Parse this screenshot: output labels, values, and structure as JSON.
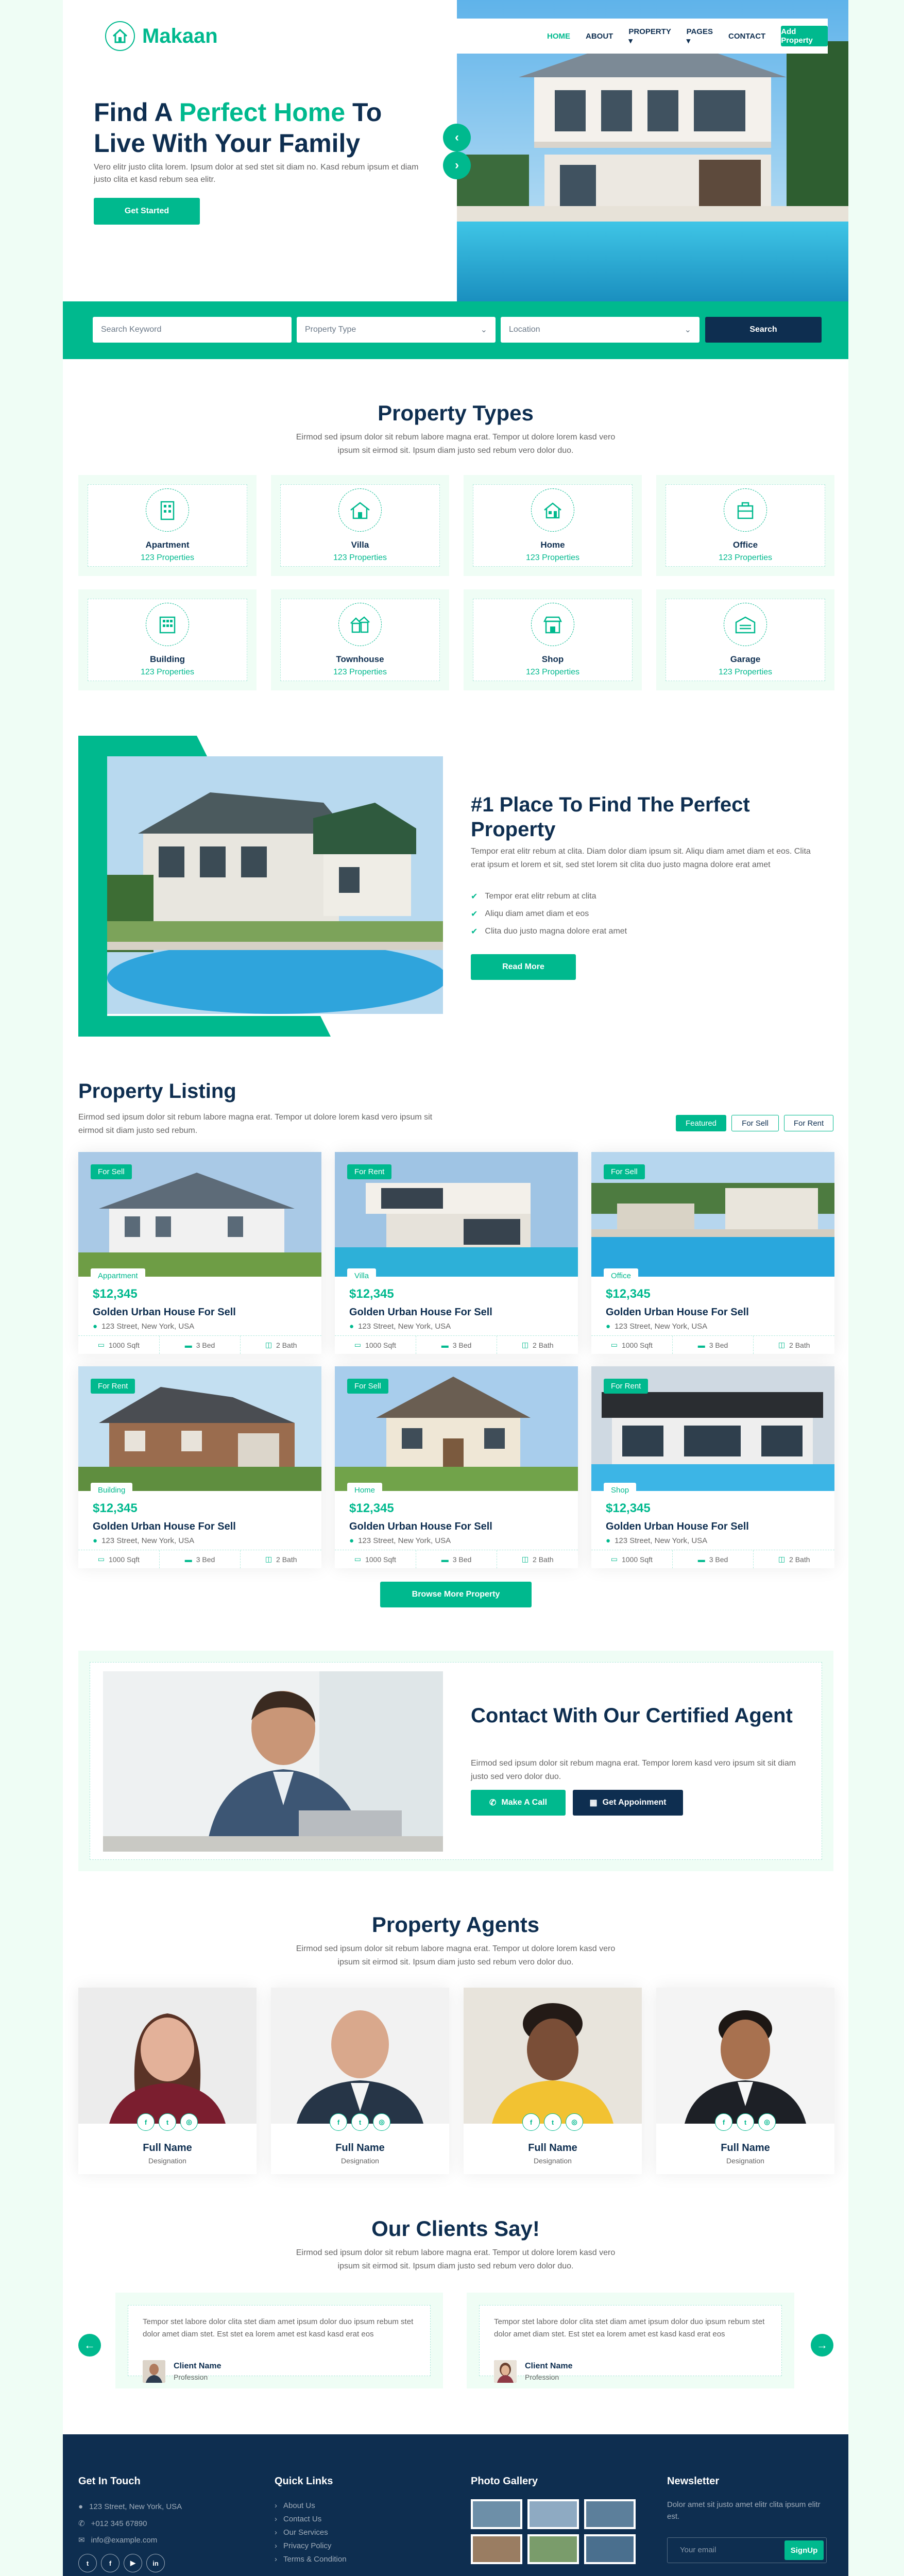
{
  "nav": {
    "logo": "Makaan",
    "links": [
      "Home",
      "About",
      "Property",
      "Pages",
      "Contact"
    ],
    "cta": "Add Property"
  },
  "hero": {
    "title_a": "Find A",
    "title_b": "Perfect Home",
    "title_c": "To",
    "title_d": "Live With Your Family",
    "text": "Vero elitr justo clita lorem. Ipsum dolor at sed stet sit diam no. Kasd rebum ipsum et diam justo clita et kasd rebum sea elitr.",
    "button": "Get Started"
  },
  "search": {
    "keyword_placeholder": "Search Keyword",
    "type_placeholder": "Property Type",
    "location_placeholder": "Location",
    "button": "Search"
  },
  "types": {
    "title": "Property Types",
    "subtitle": "Eirmod sed ipsum dolor sit rebum labore magna erat. Tempor ut dolore lorem kasd vero ipsum sit eirmod sit. Ipsum diam justo sed rebum vero dolor duo.",
    "items": [
      {
        "name": "Apartment",
        "count": "123 Properties"
      },
      {
        "name": "Villa",
        "count": "123 Properties"
      },
      {
        "name": "Home",
        "count": "123 Properties"
      },
      {
        "name": "Office",
        "count": "123 Properties"
      },
      {
        "name": "Building",
        "count": "123 Properties"
      },
      {
        "name": "Townhouse",
        "count": "123 Properties"
      },
      {
        "name": "Shop",
        "count": "123 Properties"
      },
      {
        "name": "Garage",
        "count": "123 Properties"
      }
    ]
  },
  "about": {
    "title": "#1 Place To Find The Perfect Property",
    "text": "Tempor erat elitr rebum at clita. Diam dolor diam ipsum sit. Aliqu diam amet diam et eos. Clita erat ipsum et lorem et sit, sed stet lorem sit clita duo justo magna dolore erat amet",
    "checks": [
      "Tempor erat elitr rebum at clita",
      "Aliqu diam amet diam et eos",
      "Clita duo justo magna dolore erat amet"
    ],
    "button": "Read More"
  },
  "listing": {
    "title": "Property Listing",
    "subtitle": "Eirmod sed ipsum dolor sit rebum labore magna erat. Tempor ut dolore lorem kasd vero ipsum sit eirmod sit diam justo sed rebum.",
    "tabs": [
      "Featured",
      "For Sell",
      "For Rent"
    ],
    "cards": [
      {
        "status": "For Sell",
        "type": "Appartment",
        "price": "$12,345",
        "name": "Golden Urban House For Sell",
        "address": "123 Street, New York, USA",
        "sqft": "1000 Sqft",
        "bed": "3 Bed",
        "bath": "2 Bath"
      },
      {
        "status": "For Rent",
        "type": "Villa",
        "price": "$12,345",
        "name": "Golden Urban House For Sell",
        "address": "123 Street, New York, USA",
        "sqft": "1000 Sqft",
        "bed": "3 Bed",
        "bath": "2 Bath"
      },
      {
        "status": "For Sell",
        "type": "Office",
        "price": "$12,345",
        "name": "Golden Urban House For Sell",
        "address": "123 Street, New York, USA",
        "sqft": "1000 Sqft",
        "bed": "3 Bed",
        "bath": "2 Bath"
      },
      {
        "status": "For Rent",
        "type": "Building",
        "price": "$12,345",
        "name": "Golden Urban House For Sell",
        "address": "123 Street, New York, USA",
        "sqft": "1000 Sqft",
        "bed": "3 Bed",
        "bath": "2 Bath"
      },
      {
        "status": "For Sell",
        "type": "Home",
        "price": "$12,345",
        "name": "Golden Urban House For Sell",
        "address": "123 Street, New York, USA",
        "sqft": "1000 Sqft",
        "bed": "3 Bed",
        "bath": "2 Bath"
      },
      {
        "status": "For Rent",
        "type": "Shop",
        "price": "$12,345",
        "name": "Golden Urban House For Sell",
        "address": "123 Street, New York, USA",
        "sqft": "1000 Sqft",
        "bed": "3 Bed",
        "bath": "2 Bath"
      }
    ],
    "more": "Browse More Property"
  },
  "contact": {
    "title": "Contact With Our Certified Agent",
    "text": "Eirmod sed ipsum dolor sit rebum magna erat. Tempor lorem kasd vero ipsum sit sit diam justo sed vero dolor duo.",
    "call": "Make A Call",
    "appointment": "Get Appoinment"
  },
  "agents": {
    "title": "Property Agents",
    "subtitle": "Eirmod sed ipsum dolor sit rebum labore magna erat. Tempor ut dolore lorem kasd vero ipsum sit eirmod sit. Ipsum diam justo sed rebum vero dolor duo.",
    "items": [
      {
        "name": "Full Name",
        "role": "Designation"
      },
      {
        "name": "Full Name",
        "role": "Designation"
      },
      {
        "name": "Full Name",
        "role": "Designation"
      },
      {
        "name": "Full Name",
        "role": "Designation"
      }
    ]
  },
  "clients": {
    "title": "Our Clients Say!",
    "subtitle": "Eirmod sed ipsum dolor sit rebum labore magna erat. Tempor ut dolore lorem kasd vero ipsum sit eirmod sit. Ipsum diam justo sed rebum vero dolor duo.",
    "items": [
      {
        "text": "Tempor stet labore dolor clita stet diam amet ipsum dolor duo ipsum rebum stet dolor amet diam stet. Est stet ea lorem amet est kasd kasd erat eos",
        "name": "Client Name",
        "role": "Profession"
      },
      {
        "text": "Tempor stet labore dolor clita stet diam amet ipsum dolor duo ipsum rebum stet dolor amet diam stet. Est stet ea lorem amet est kasd kasd erat eos",
        "name": "Client Name",
        "role": "Profession"
      }
    ]
  },
  "footer": {
    "touch_title": "Get In Touch",
    "address": "123 Street, New York, USA",
    "phone": "+012 345 67890",
    "email": "info@example.com",
    "links_title": "Quick Links",
    "links": [
      "About Us",
      "Contact Us",
      "Our Services",
      "Privacy Policy",
      "Terms & Condition"
    ],
    "gallery_title": "Photo Gallery",
    "news_title": "Newsletter",
    "news_text": "Dolor amet sit justo amet elitr clita ipsum elitr est.",
    "news_placeholder": "Your email",
    "news_button": "SignUp"
  },
  "colors": {
    "primary": "#00b98e",
    "dark": "#0e2e50",
    "light": "#effdf5"
  }
}
